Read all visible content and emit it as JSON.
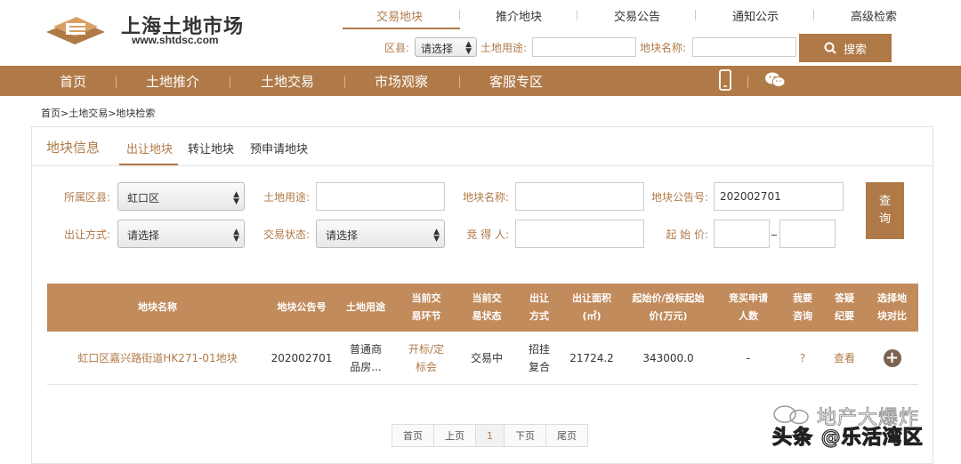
{
  "header": {
    "logo_title": "上海土地市场",
    "logo_url": "www.shtdsc.com",
    "top_nav": [
      "交易地块",
      "推介地块",
      "交易公告",
      "通知公示",
      "高级检索"
    ],
    "search": {
      "district_label": "区县:",
      "district_value": "请选择",
      "land_use_label": "土地用途:",
      "land_use_value": "",
      "plot_name_label": "地块名称:",
      "plot_name_value": "",
      "button_label": "搜索"
    }
  },
  "main_nav": [
    "首页",
    "土地推介",
    "土地交易",
    "市场观察",
    "客服专区"
  ],
  "breadcrumb": "首页>土地交易>地块检索",
  "panel": {
    "title": "地块信息",
    "tabs": [
      "出让地块",
      "转让地块",
      "预申请地块"
    ],
    "filters": {
      "district_label": "所属区县:",
      "district_value": "虹口区",
      "land_use_label": "土地用途:",
      "land_use_value": "",
      "plot_name_label": "地块名称:",
      "plot_name_value": "",
      "notice_no_label": "地块公告号:",
      "notice_no_value": "202002701",
      "sale_method_label": "出让方式:",
      "sale_method_value": "请选择",
      "status_label": "交易状态:",
      "status_value": "请选择",
      "bidder_label": "竞 得 人:",
      "bidder_value": "",
      "start_price_label": "起 始 价:",
      "price_from": "",
      "price_dash": "_",
      "price_to": "",
      "query_label_1": "查",
      "query_label_2": "询"
    },
    "table": {
      "headers": [
        "地块名称",
        "地块公告号",
        "土地用途",
        "当前交易环节",
        "当前交易状态",
        "出让方式",
        "出让面积(㎡)",
        "起始价/投标起始价(万元)",
        "竞买申请人数",
        "我要咨询",
        "答疑纪要",
        "选择地块对比"
      ],
      "rows": [
        {
          "name": "虹口区嘉兴路街道HK271-01地块",
          "notice_no": "202002701",
          "land_use": "普通商品房...",
          "stage": "开标/定标会",
          "status": "交易中",
          "method": "招挂复合",
          "area": "21724.2",
          "start_price": "343000.0",
          "applicants": "-",
          "consult": "?",
          "qa": "查看"
        }
      ]
    },
    "pager": [
      "首页",
      "上页",
      "1",
      "下页",
      "尾页"
    ]
  },
  "watermark": {
    "line1": "地产大爆炸",
    "line2": "头条 @乐活湾区"
  },
  "colors": {
    "brand": "#b07a48",
    "table_header": "#c28b5c"
  }
}
